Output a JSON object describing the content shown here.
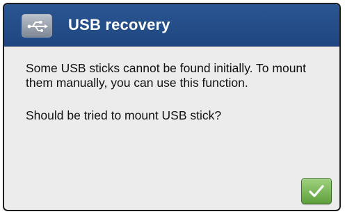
{
  "dialog": {
    "title": "USB recovery",
    "icon": "usb-icon",
    "message": "Some USB sticks cannot be found initially. To mount them manually, you can use this function.",
    "question": "Should be tried to mount USB stick?",
    "confirm_icon": "checkmark-icon"
  },
  "colors": {
    "titlebar": "#2b5692",
    "background": "#ececec",
    "confirm": "#6fb046"
  }
}
